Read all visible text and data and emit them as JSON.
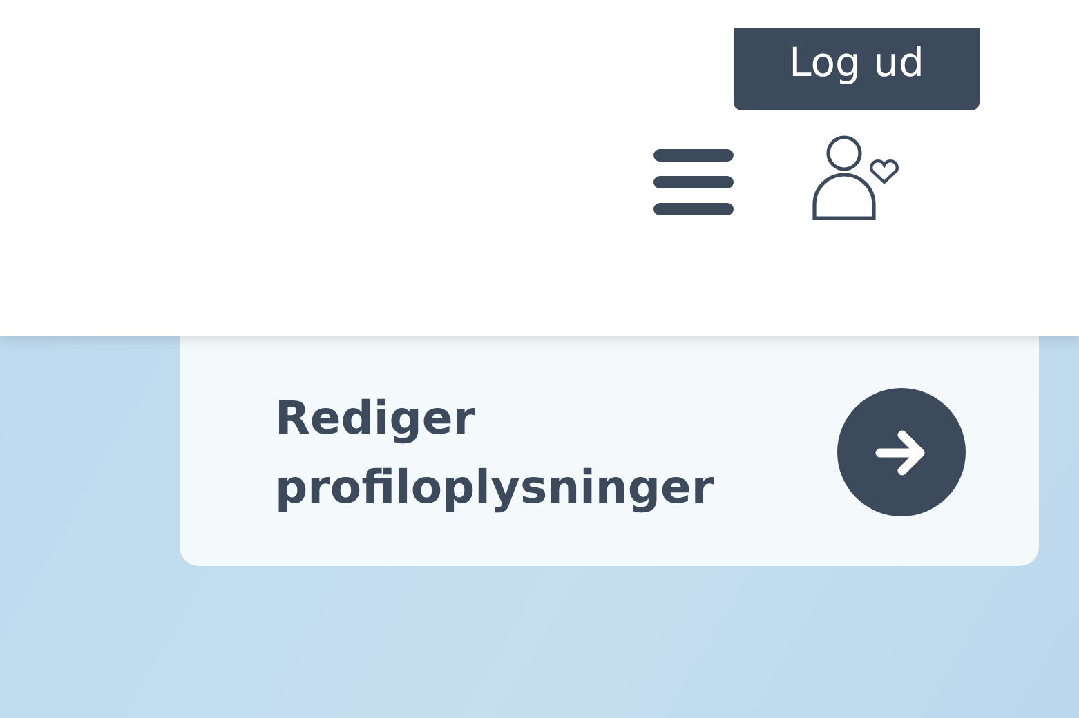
{
  "header": {
    "logout_button": "Log ud"
  },
  "card": {
    "title": "Rediger profiloplysninger"
  }
}
